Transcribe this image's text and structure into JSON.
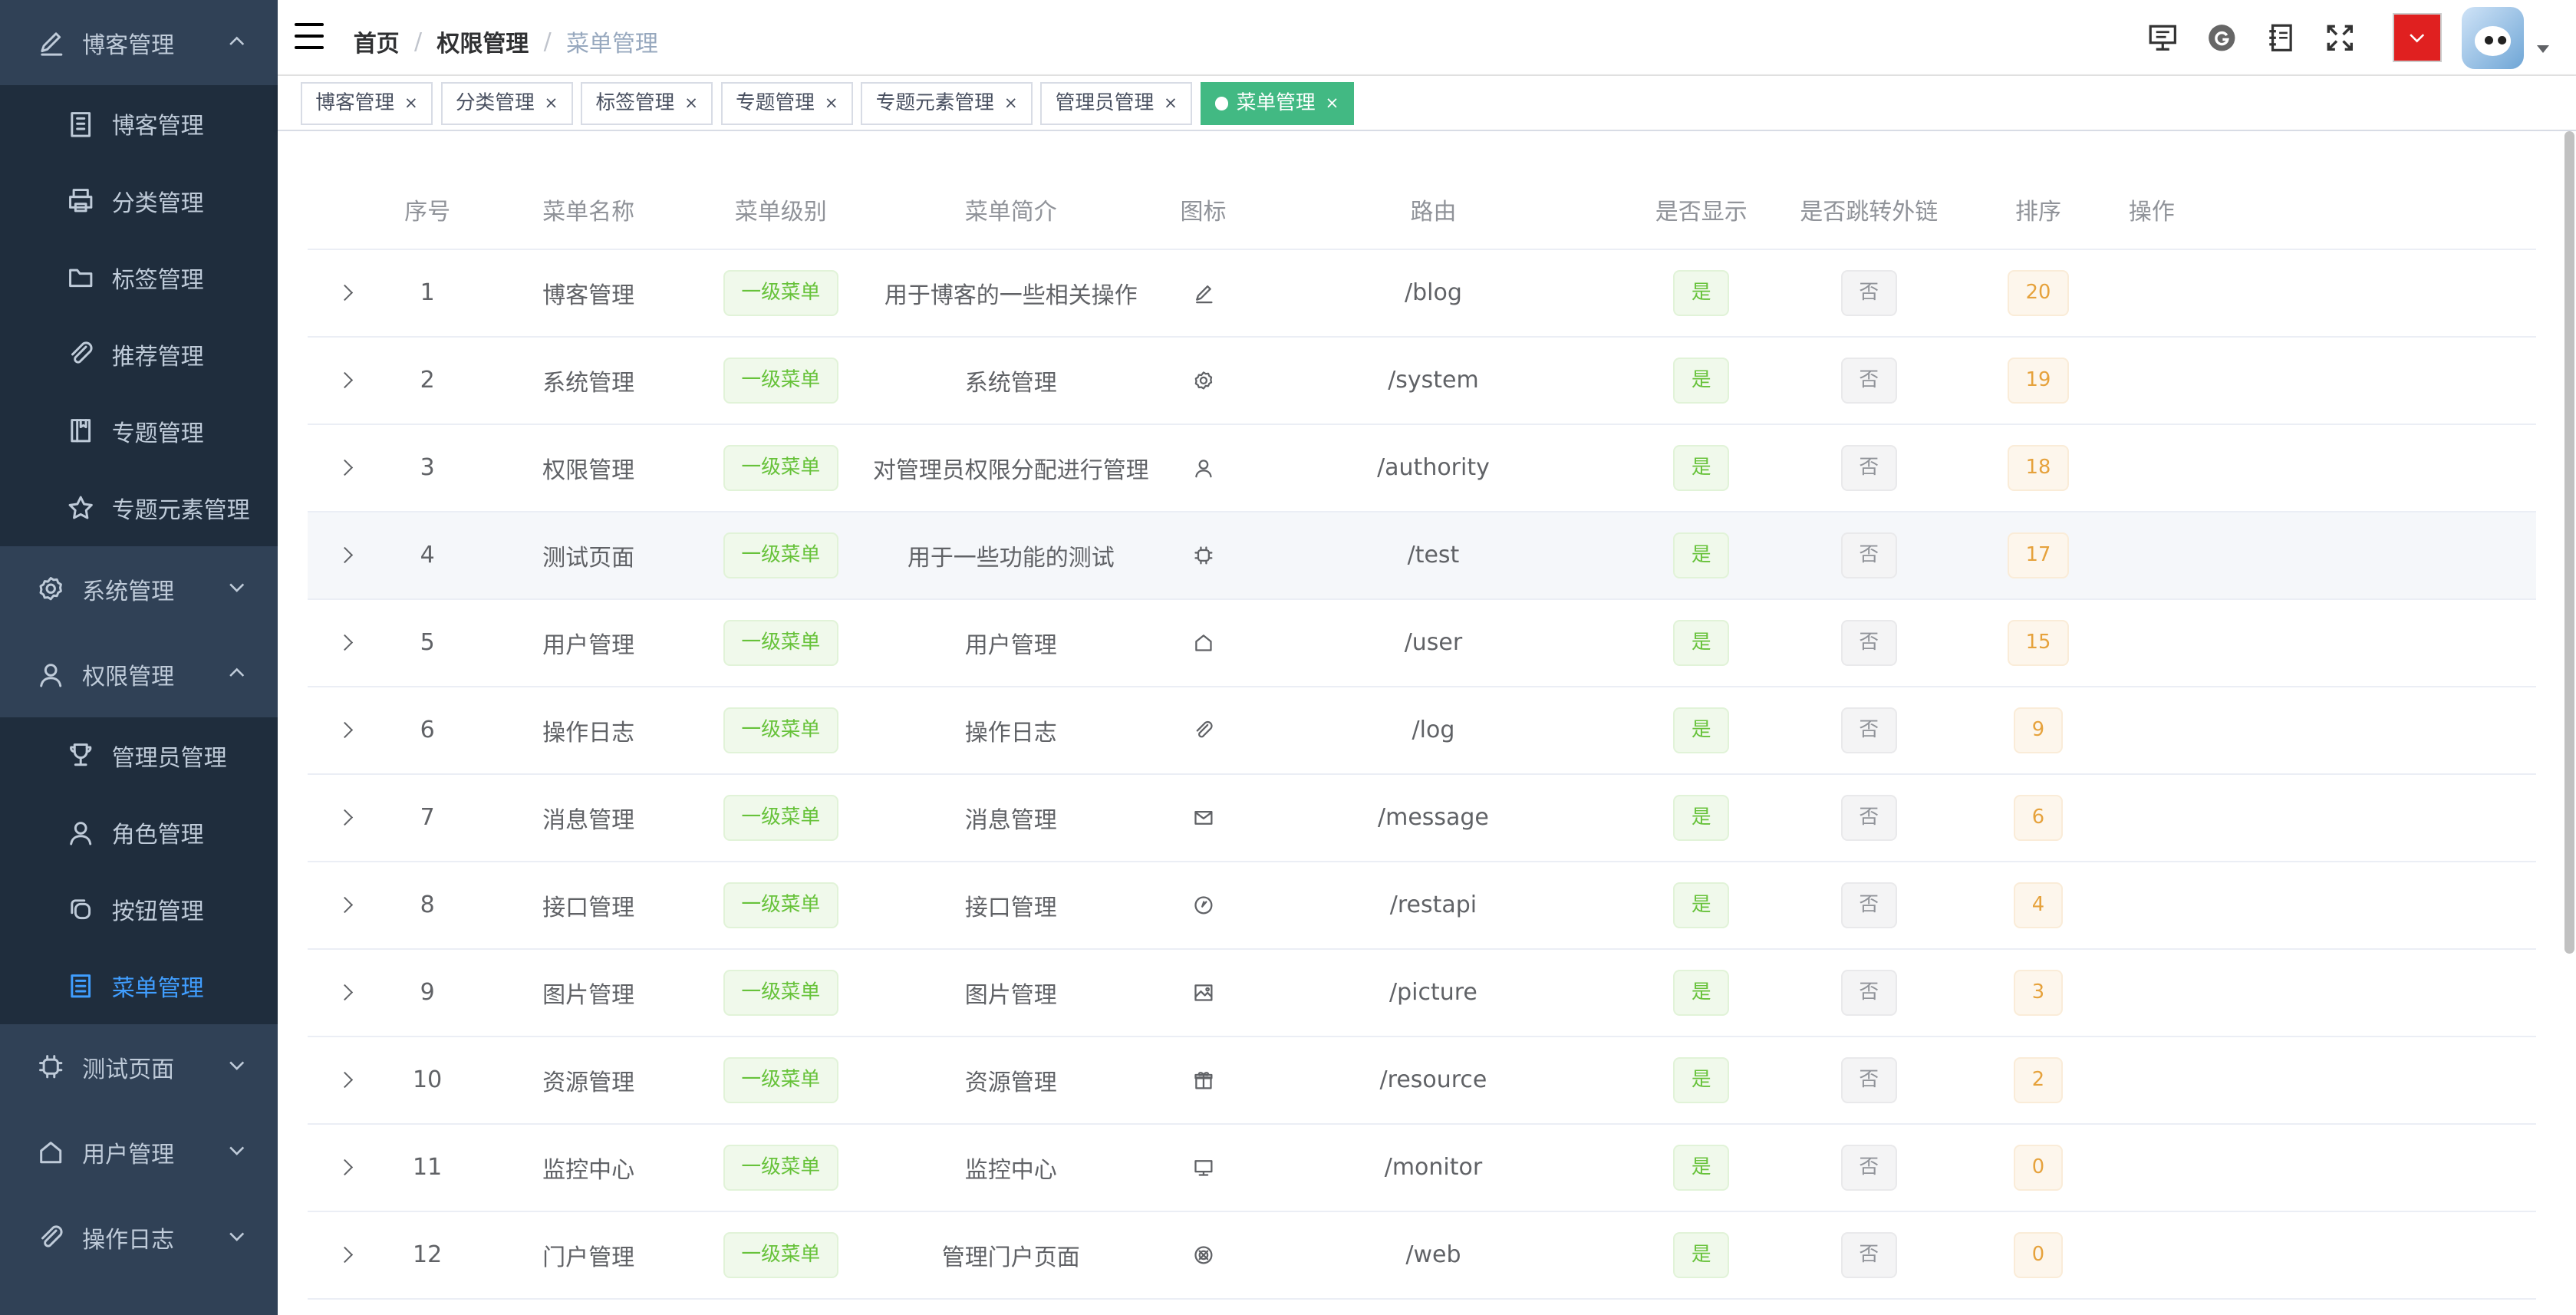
{
  "sidebar": {
    "groups": [
      {
        "label": "博客管理",
        "icon": "pen-icon",
        "expanded": true,
        "items": [
          {
            "label": "博客管理",
            "icon": "document-icon"
          },
          {
            "label": "分类管理",
            "icon": "printer-icon"
          },
          {
            "label": "标签管理",
            "icon": "folder-icon"
          },
          {
            "label": "推荐管理",
            "icon": "paperclip-icon"
          },
          {
            "label": "专题管理",
            "icon": "book-icon"
          },
          {
            "label": "专题元素管理",
            "icon": "star-icon"
          }
        ]
      },
      {
        "label": "系统管理",
        "icon": "gear-icon",
        "expanded": false
      },
      {
        "label": "权限管理",
        "icon": "user-icon",
        "expanded": true,
        "items": [
          {
            "label": "管理员管理",
            "icon": "trophy-icon"
          },
          {
            "label": "角色管理",
            "icon": "user-icon"
          },
          {
            "label": "按钮管理",
            "icon": "copy-icon"
          },
          {
            "label": "菜单管理",
            "icon": "list-icon",
            "active": true
          }
        ]
      },
      {
        "label": "测试页面",
        "icon": "cpu-icon",
        "expanded": false
      },
      {
        "label": "用户管理",
        "icon": "house-icon",
        "expanded": false
      },
      {
        "label": "操作日志",
        "icon": "paperclip-icon",
        "expanded": false
      }
    ]
  },
  "breadcrumb": [
    "首页",
    "权限管理",
    "菜单管理"
  ],
  "tags": [
    {
      "label": "博客管理"
    },
    {
      "label": "分类管理"
    },
    {
      "label": "标签管理"
    },
    {
      "label": "专题管理"
    },
    {
      "label": "专题元素管理"
    },
    {
      "label": "管理员管理"
    },
    {
      "label": "菜单管理",
      "active": true
    }
  ],
  "table": {
    "headers": [
      "序号",
      "菜单名称",
      "菜单级别",
      "菜单简介",
      "图标",
      "路由",
      "是否显示",
      "是否跳转外链",
      "排序",
      "操作"
    ],
    "rows": [
      {
        "idx": "1",
        "name": "博客管理",
        "level": "一级菜单",
        "summary": "用于博客的一些相关操作",
        "icon": "pen-icon",
        "route": "/blog",
        "show": "是",
        "external": "否",
        "sort": "20"
      },
      {
        "idx": "2",
        "name": "系统管理",
        "level": "一级菜单",
        "summary": "系统管理",
        "icon": "gear-icon",
        "route": "/system",
        "show": "是",
        "external": "否",
        "sort": "19"
      },
      {
        "idx": "3",
        "name": "权限管理",
        "level": "一级菜单",
        "summary": "对管理员权限分配进行管理",
        "icon": "user-icon",
        "route": "/authority",
        "show": "是",
        "external": "否",
        "sort": "18"
      },
      {
        "idx": "4",
        "name": "测试页面",
        "level": "一级菜单",
        "summary": "用于一些功能的测试",
        "icon": "cpu-icon",
        "route": "/test",
        "show": "是",
        "external": "否",
        "sort": "17"
      },
      {
        "idx": "5",
        "name": "用户管理",
        "level": "一级菜单",
        "summary": "用户管理",
        "icon": "house-icon",
        "route": "/user",
        "show": "是",
        "external": "否",
        "sort": "15"
      },
      {
        "idx": "6",
        "name": "操作日志",
        "level": "一级菜单",
        "summary": "操作日志",
        "icon": "paperclip-icon",
        "route": "/log",
        "show": "是",
        "external": "否",
        "sort": "9"
      },
      {
        "idx": "7",
        "name": "消息管理",
        "level": "一级菜单",
        "summary": "消息管理",
        "icon": "mail-icon",
        "route": "/message",
        "show": "是",
        "external": "否",
        "sort": "6"
      },
      {
        "idx": "8",
        "name": "接口管理",
        "level": "一级菜单",
        "summary": "接口管理",
        "icon": "compass-icon",
        "route": "/restapi",
        "show": "是",
        "external": "否",
        "sort": "4"
      },
      {
        "idx": "9",
        "name": "图片管理",
        "level": "一级菜单",
        "summary": "图片管理",
        "icon": "picture-icon",
        "route": "/picture",
        "show": "是",
        "external": "否",
        "sort": "3"
      },
      {
        "idx": "10",
        "name": "资源管理",
        "level": "一级菜单",
        "summary": "资源管理",
        "icon": "gift-icon",
        "route": "/resource",
        "show": "是",
        "external": "否",
        "sort": "2"
      },
      {
        "idx": "11",
        "name": "监控中心",
        "level": "一级菜单",
        "summary": "监控中心",
        "icon": "monitor-icon",
        "route": "/monitor",
        "show": "是",
        "external": "否",
        "sort": "0"
      },
      {
        "idx": "12",
        "name": "门户管理",
        "level": "一级菜单",
        "summary": "管理门户页面",
        "icon": "football-icon",
        "route": "/web",
        "show": "是",
        "external": "否",
        "sort": "0"
      }
    ]
  },
  "colors": {
    "sidebar_bg": "#304156",
    "submenu_bg": "#1f2d3d",
    "active": "#409eff",
    "tag_active": "#42b983"
  }
}
